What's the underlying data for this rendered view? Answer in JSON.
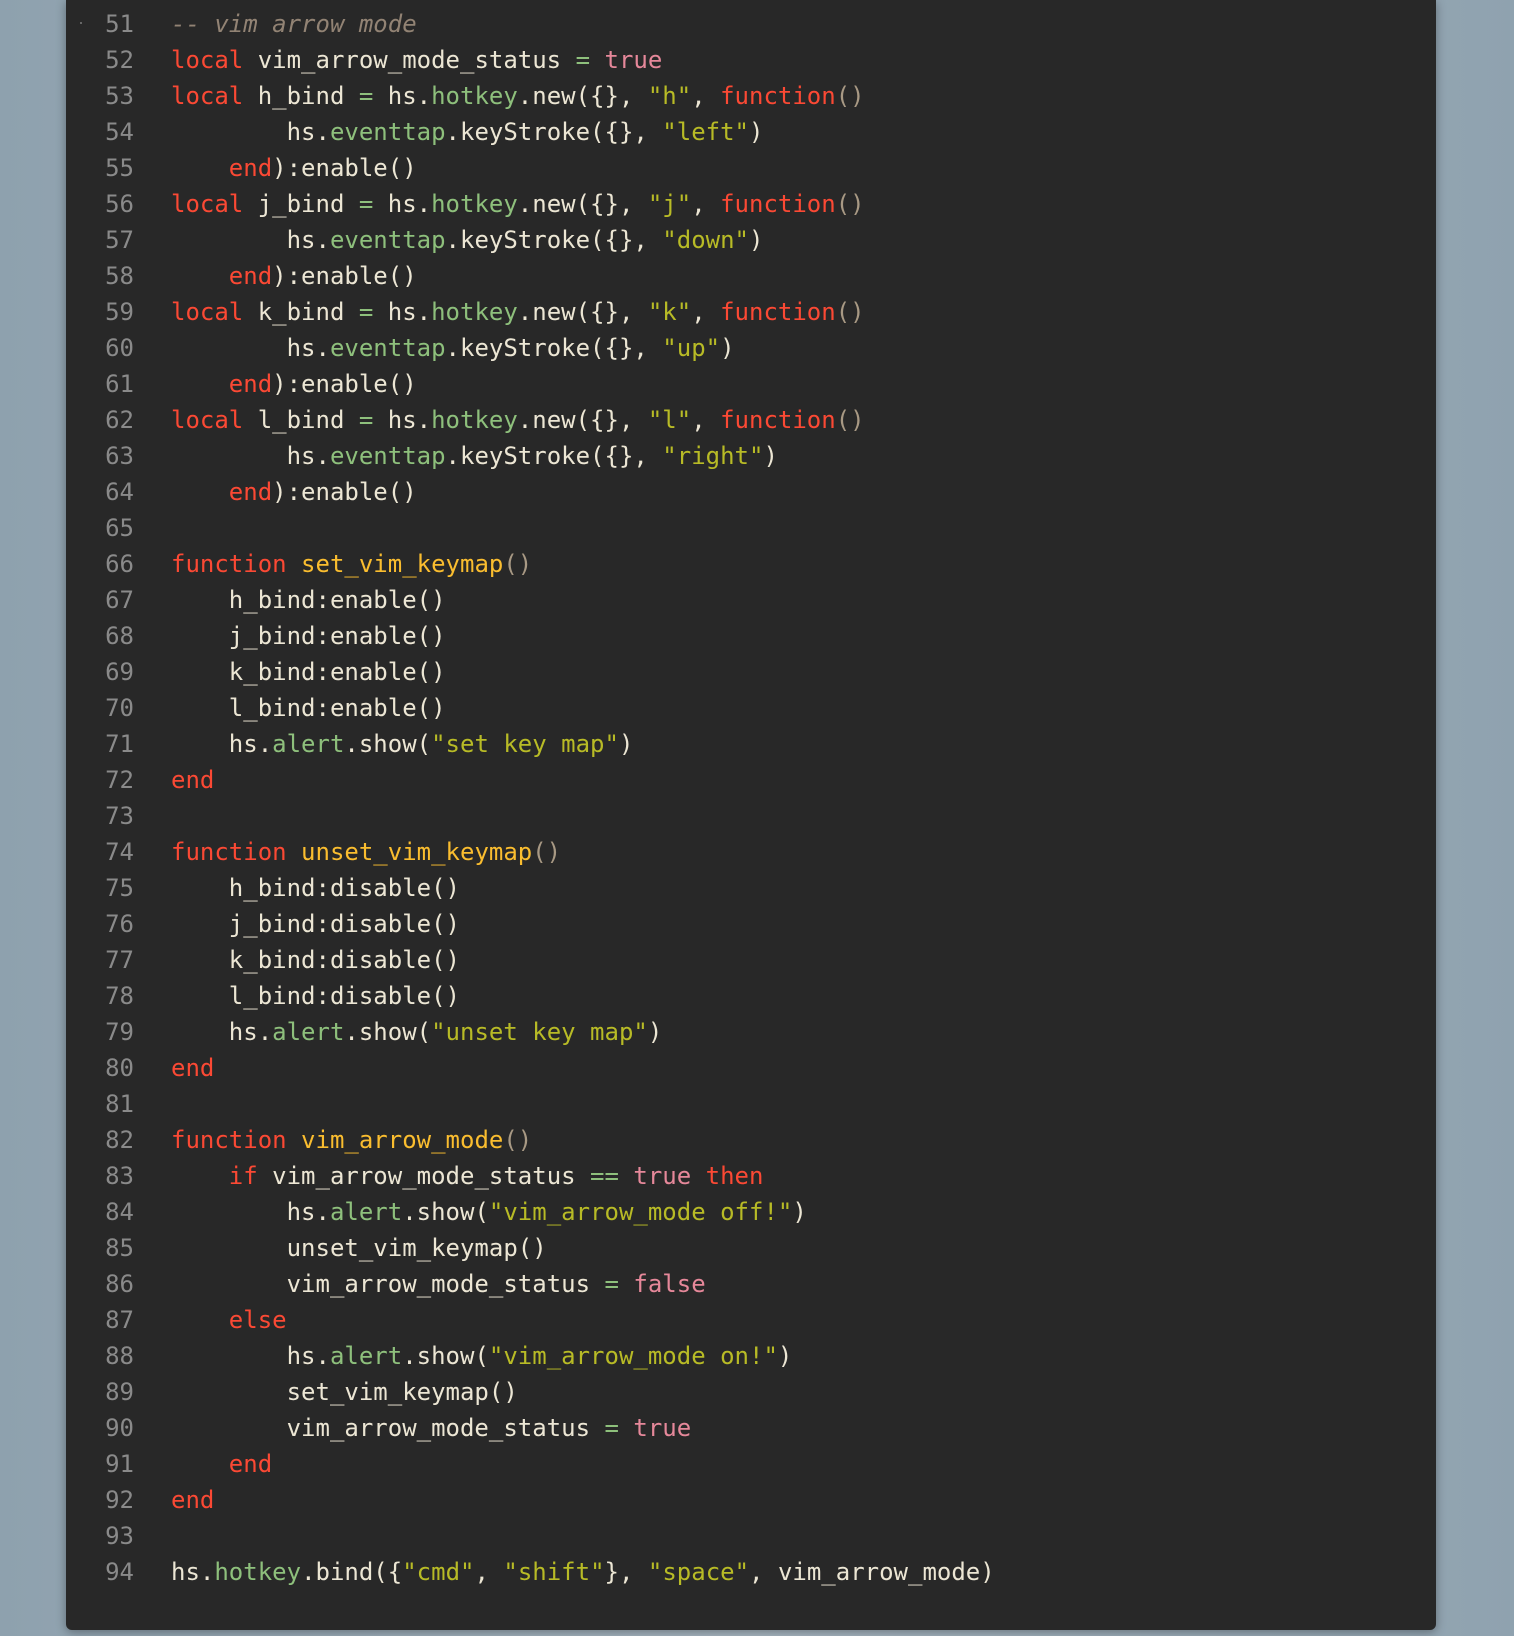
{
  "editor": {
    "lines": [
      {
        "n": "51",
        "tokens": [
          [
            "cm",
            "-- vim arrow mode"
          ]
        ]
      },
      {
        "n": "52",
        "tokens": [
          [
            "kw",
            "local"
          ],
          [
            "plain",
            " vim_arrow_mode_status "
          ],
          [
            "op",
            "="
          ],
          [
            "plain",
            " "
          ],
          [
            "bool",
            "true"
          ]
        ]
      },
      {
        "n": "53",
        "tokens": [
          [
            "kw",
            "local"
          ],
          [
            "plain",
            " h_bind "
          ],
          [
            "op",
            "="
          ],
          [
            "plain",
            " hs."
          ],
          [
            "mod",
            "hotkey"
          ],
          [
            "plain",
            ".new({}, "
          ],
          [
            "str",
            "\"h\""
          ],
          [
            "plain",
            ", "
          ],
          [
            "kw",
            "function"
          ],
          [
            "paren-dim",
            "()"
          ]
        ]
      },
      {
        "n": "54",
        "tokens": [
          [
            "plain",
            "        hs."
          ],
          [
            "mod",
            "eventtap"
          ],
          [
            "plain",
            ".keyStroke({}, "
          ],
          [
            "str",
            "\"left\""
          ],
          [
            "plain",
            ")"
          ]
        ]
      },
      {
        "n": "55",
        "tokens": [
          [
            "plain",
            "    "
          ],
          [
            "kw",
            "end"
          ],
          [
            "plain",
            "):enable()"
          ]
        ]
      },
      {
        "n": "56",
        "tokens": [
          [
            "kw",
            "local"
          ],
          [
            "plain",
            " j_bind "
          ],
          [
            "op",
            "="
          ],
          [
            "plain",
            " hs."
          ],
          [
            "mod",
            "hotkey"
          ],
          [
            "plain",
            ".new({}, "
          ],
          [
            "str",
            "\"j\""
          ],
          [
            "plain",
            ", "
          ],
          [
            "kw",
            "function"
          ],
          [
            "paren-dim",
            "()"
          ]
        ]
      },
      {
        "n": "57",
        "tokens": [
          [
            "plain",
            "        hs."
          ],
          [
            "mod",
            "eventtap"
          ],
          [
            "plain",
            ".keyStroke({}, "
          ],
          [
            "str",
            "\"down\""
          ],
          [
            "plain",
            ")"
          ]
        ]
      },
      {
        "n": "58",
        "tokens": [
          [
            "plain",
            "    "
          ],
          [
            "kw",
            "end"
          ],
          [
            "plain",
            "):enable()"
          ]
        ]
      },
      {
        "n": "59",
        "tokens": [
          [
            "kw",
            "local"
          ],
          [
            "plain",
            " k_bind "
          ],
          [
            "op",
            "="
          ],
          [
            "plain",
            " hs."
          ],
          [
            "mod",
            "hotkey"
          ],
          [
            "plain",
            ".new({}, "
          ],
          [
            "str",
            "\"k\""
          ],
          [
            "plain",
            ", "
          ],
          [
            "kw",
            "function"
          ],
          [
            "paren-dim",
            "()"
          ]
        ]
      },
      {
        "n": "60",
        "tokens": [
          [
            "plain",
            "        hs."
          ],
          [
            "mod",
            "eventtap"
          ],
          [
            "plain",
            ".keyStroke({}, "
          ],
          [
            "str",
            "\"up\""
          ],
          [
            "plain",
            ")"
          ]
        ]
      },
      {
        "n": "61",
        "tokens": [
          [
            "plain",
            "    "
          ],
          [
            "kw",
            "end"
          ],
          [
            "plain",
            "):enable()"
          ]
        ]
      },
      {
        "n": "62",
        "tokens": [
          [
            "kw",
            "local"
          ],
          [
            "plain",
            " l_bind "
          ],
          [
            "op",
            "="
          ],
          [
            "plain",
            " hs."
          ],
          [
            "mod",
            "hotkey"
          ],
          [
            "plain",
            ".new({}, "
          ],
          [
            "str",
            "\"l\""
          ],
          [
            "plain",
            ", "
          ],
          [
            "kw",
            "function"
          ],
          [
            "paren-dim",
            "()"
          ]
        ]
      },
      {
        "n": "63",
        "tokens": [
          [
            "plain",
            "        hs."
          ],
          [
            "mod",
            "eventtap"
          ],
          [
            "plain",
            ".keyStroke({}, "
          ],
          [
            "str",
            "\"right\""
          ],
          [
            "plain",
            ")"
          ]
        ]
      },
      {
        "n": "64",
        "tokens": [
          [
            "plain",
            "    "
          ],
          [
            "kw",
            "end"
          ],
          [
            "plain",
            "):enable()"
          ]
        ]
      },
      {
        "n": "65",
        "tokens": []
      },
      {
        "n": "66",
        "tokens": [
          [
            "kw",
            "function"
          ],
          [
            "plain",
            " "
          ],
          [
            "fn",
            "set_vim_keymap"
          ],
          [
            "paren-dim",
            "()"
          ]
        ]
      },
      {
        "n": "67",
        "tokens": [
          [
            "plain",
            "    h_bind:enable()"
          ]
        ]
      },
      {
        "n": "68",
        "tokens": [
          [
            "plain",
            "    j_bind:enable()"
          ]
        ]
      },
      {
        "n": "69",
        "tokens": [
          [
            "plain",
            "    k_bind:enable()"
          ]
        ]
      },
      {
        "n": "70",
        "tokens": [
          [
            "plain",
            "    l_bind:enable()"
          ]
        ]
      },
      {
        "n": "71",
        "tokens": [
          [
            "plain",
            "    hs."
          ],
          [
            "mod",
            "alert"
          ],
          [
            "plain",
            ".show("
          ],
          [
            "str",
            "\"set key map\""
          ],
          [
            "plain",
            ")"
          ]
        ]
      },
      {
        "n": "72",
        "tokens": [
          [
            "kw",
            "end"
          ]
        ]
      },
      {
        "n": "73",
        "tokens": []
      },
      {
        "n": "74",
        "tokens": [
          [
            "kw",
            "function"
          ],
          [
            "plain",
            " "
          ],
          [
            "fn",
            "unset_vim_keymap"
          ],
          [
            "paren-dim",
            "()"
          ]
        ]
      },
      {
        "n": "75",
        "tokens": [
          [
            "plain",
            "    h_bind:disable()"
          ]
        ]
      },
      {
        "n": "76",
        "tokens": [
          [
            "plain",
            "    j_bind:disable()"
          ]
        ]
      },
      {
        "n": "77",
        "tokens": [
          [
            "plain",
            "    k_bind:disable()"
          ]
        ]
      },
      {
        "n": "78",
        "tokens": [
          [
            "plain",
            "    l_bind:disable()"
          ]
        ]
      },
      {
        "n": "79",
        "tokens": [
          [
            "plain",
            "    hs."
          ],
          [
            "mod",
            "alert"
          ],
          [
            "plain",
            ".show("
          ],
          [
            "str",
            "\"unset key map\""
          ],
          [
            "plain",
            ")"
          ]
        ]
      },
      {
        "n": "80",
        "tokens": [
          [
            "kw",
            "end"
          ]
        ]
      },
      {
        "n": "81",
        "tokens": []
      },
      {
        "n": "82",
        "tokens": [
          [
            "kw",
            "function"
          ],
          [
            "plain",
            " "
          ],
          [
            "fn",
            "vim_arrow_mode"
          ],
          [
            "paren-dim",
            "()"
          ]
        ]
      },
      {
        "n": "83",
        "tokens": [
          [
            "plain",
            "    "
          ],
          [
            "kw",
            "if"
          ],
          [
            "plain",
            " vim_arrow_mode_status "
          ],
          [
            "op",
            "=="
          ],
          [
            "plain",
            " "
          ],
          [
            "bool",
            "true"
          ],
          [
            "plain",
            " "
          ],
          [
            "kw",
            "then"
          ]
        ]
      },
      {
        "n": "84",
        "tokens": [
          [
            "plain",
            "        hs."
          ],
          [
            "mod",
            "alert"
          ],
          [
            "plain",
            ".show("
          ],
          [
            "str",
            "\"vim_arrow_mode off!\""
          ],
          [
            "plain",
            ")"
          ]
        ]
      },
      {
        "n": "85",
        "tokens": [
          [
            "plain",
            "        unset_vim_keymap()"
          ]
        ]
      },
      {
        "n": "86",
        "tokens": [
          [
            "plain",
            "        vim_arrow_mode_status "
          ],
          [
            "op",
            "="
          ],
          [
            "plain",
            " "
          ],
          [
            "bool",
            "false"
          ]
        ]
      },
      {
        "n": "87",
        "tokens": [
          [
            "plain",
            "    "
          ],
          [
            "kw",
            "else"
          ]
        ]
      },
      {
        "n": "88",
        "tokens": [
          [
            "plain",
            "        hs."
          ],
          [
            "mod",
            "alert"
          ],
          [
            "plain",
            ".show("
          ],
          [
            "str",
            "\"vim_arrow_mode on!\""
          ],
          [
            "plain",
            ")"
          ]
        ]
      },
      {
        "n": "89",
        "tokens": [
          [
            "plain",
            "        set_vim_keymap()"
          ]
        ]
      },
      {
        "n": "90",
        "tokens": [
          [
            "plain",
            "        vim_arrow_mode_status "
          ],
          [
            "op",
            "="
          ],
          [
            "plain",
            " "
          ],
          [
            "bool",
            "true"
          ]
        ]
      },
      {
        "n": "91",
        "tokens": [
          [
            "plain",
            "    "
          ],
          [
            "kw",
            "end"
          ]
        ]
      },
      {
        "n": "92",
        "tokens": [
          [
            "kw",
            "end"
          ]
        ]
      },
      {
        "n": "93",
        "tokens": []
      },
      {
        "n": "94",
        "tokens": [
          [
            "plain",
            "hs."
          ],
          [
            "mod",
            "hotkey"
          ],
          [
            "plain",
            ".bind({"
          ],
          [
            "str",
            "\"cmd\""
          ],
          [
            "plain",
            ", "
          ],
          [
            "str",
            "\"shift\""
          ],
          [
            "plain",
            "}, "
          ],
          [
            "str",
            "\"space\""
          ],
          [
            "plain",
            ", vim_arrow_mode)"
          ]
        ]
      }
    ]
  },
  "colors": {
    "background": "#282828",
    "keyword": "#fb4934",
    "boolean": "#e6889a",
    "string": "#b8bb26",
    "function_name": "#fabd2f",
    "module": "#8ec07c",
    "comment": "#928374",
    "text": "#ece6d4",
    "line_number": "#8a8a8a"
  }
}
